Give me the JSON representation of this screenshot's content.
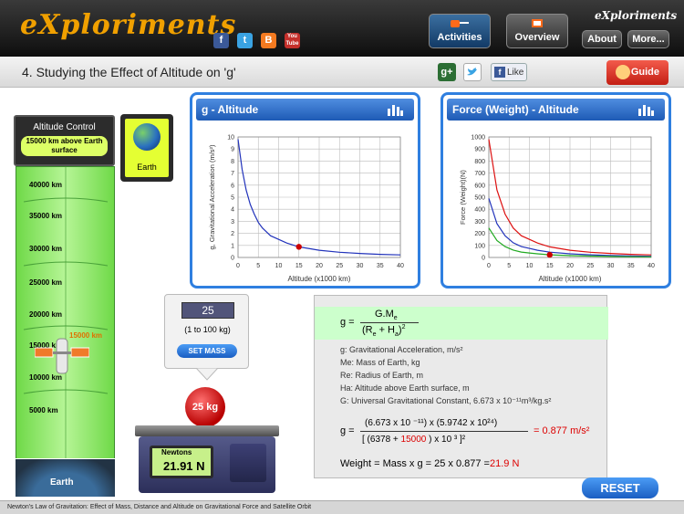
{
  "header": {
    "logo": "eXploriments",
    "brand_small": "eXploriments",
    "social": [
      "f",
      "t",
      "B",
      "You Tube"
    ],
    "nav": {
      "activities": "Activities",
      "overview": "Overview",
      "about": "About",
      "more": "More..."
    }
  },
  "titlebar": {
    "title": "4. Studying the Effect of Altitude on 'g'",
    "gplus": "g+",
    "like": "Like",
    "guide": "Guide"
  },
  "altitude": {
    "control_title": "Altitude Control",
    "value_label": "15000 km above Earth surface",
    "ticks": [
      "40000 km",
      "35000 km",
      "30000 km",
      "25000 km",
      "20000 km",
      "15000 km",
      "10000 km",
      "5000 km"
    ],
    "satellite_label": "15000 km",
    "earth_label": "Earth",
    "earth_button_label": "Earth"
  },
  "chart_data": [
    {
      "type": "line",
      "title": "g - Altitude",
      "xlabel": "Altitude (x1000 km)",
      "ylabel": "g, Gravitational Acceleration (m/s²)",
      "xlim": [
        0,
        40
      ],
      "ylim": [
        0,
        10
      ],
      "xticks": [
        0,
        5,
        10,
        15,
        20,
        25,
        30,
        35,
        40
      ],
      "yticks": [
        0,
        1,
        2,
        3,
        4,
        5,
        6,
        7,
        8,
        9,
        10
      ],
      "grid": true,
      "series": [
        {
          "color": "#2233bb",
          "x": [
            0,
            1,
            2,
            3,
            4,
            5,
            6,
            8,
            10,
            12,
            15,
            20,
            25,
            30,
            35,
            40
          ],
          "y": [
            9.8,
            7.3,
            5.6,
            4.4,
            3.6,
            2.9,
            2.45,
            1.8,
            1.5,
            1.2,
            0.88,
            0.6,
            0.43,
            0.33,
            0.26,
            0.21
          ]
        }
      ],
      "marker": {
        "x": 15,
        "y": 0.88,
        "color": "#cc0000"
      }
    },
    {
      "type": "line",
      "title": "Force (Weight) - Altitude",
      "xlabel": "Altitude (x1000 km)",
      "ylabel": "Force (Weight)(N)",
      "xlim": [
        0,
        40
      ],
      "ylim": [
        0,
        1000
      ],
      "xticks": [
        0,
        5,
        10,
        15,
        20,
        25,
        30,
        35,
        40
      ],
      "yticks": [
        0,
        100,
        200,
        300,
        400,
        500,
        600,
        700,
        800,
        900,
        1000
      ],
      "grid": true,
      "series": [
        {
          "color": "#dd1111",
          "x": [
            0,
            2,
            4,
            6,
            8,
            10,
            12,
            15,
            20,
            25,
            30,
            35,
            40
          ],
          "y": [
            980,
            560,
            360,
            245,
            180,
            150,
            120,
            88,
            60,
            43,
            33,
            26,
            21
          ]
        },
        {
          "color": "#2233bb",
          "x": [
            0,
            2,
            4,
            6,
            8,
            10,
            12,
            15,
            20,
            25,
            30,
            35,
            40
          ],
          "y": [
            490,
            280,
            180,
            122,
            90,
            75,
            60,
            44,
            30,
            22,
            17,
            13,
            10
          ]
        },
        {
          "color": "#22aa22",
          "x": [
            0,
            2,
            4,
            6,
            8,
            10,
            12,
            15,
            20,
            25,
            30,
            35,
            40
          ],
          "y": [
            245,
            140,
            90,
            61,
            45,
            37,
            30,
            22,
            15,
            11,
            8,
            6,
            5
          ]
        }
      ],
      "marker": {
        "x": 15,
        "y": 22,
        "color": "#cc0000"
      }
    }
  ],
  "mass": {
    "value": "25",
    "range_label": "(1 to 100 kg)",
    "set_label": "SET MASS",
    "ball_label": "25 kg",
    "scale_title": "Newtons",
    "scale_value": "21.91 N"
  },
  "formula": {
    "g_eq": "g =",
    "numerator": "G.M",
    "num_sub": "e",
    "denominator": "(R",
    "den_sub1": "e",
    "den_mid": " + H",
    "den_sub2": "a",
    "den_end": ")",
    "den_exp": "2",
    "desc": [
      "g: Gravitational Acceleration, m/s²",
      "Me: Mass of Earth, kg",
      "Re: Radius of Earth, m",
      "Ha: Altitude above Earth surface, m",
      "G: Universal Gravitational Constant, 6.673 x 10⁻¹¹m³/kg.s²"
    ],
    "calc_g": "g =",
    "calc_num": "(6.673 x 10 ⁻¹¹) x (5.9742 x 10²⁴)",
    "calc_den_pre": "[ (6378 + ",
    "calc_den_alt": "15000",
    "calc_den_post": " ) x 10 ³ ]²",
    "calc_result": "= 0.877 m/s²",
    "weight_pre": "Weight = Mass x g = 25 x   0.877 =",
    "weight_result": "21.9 N"
  },
  "reset_label": "RESET",
  "footer": "Newton's Law of Gravitation: Effect of Mass, Distance and Altitude on Gravitational Force and Satellite Orbit"
}
